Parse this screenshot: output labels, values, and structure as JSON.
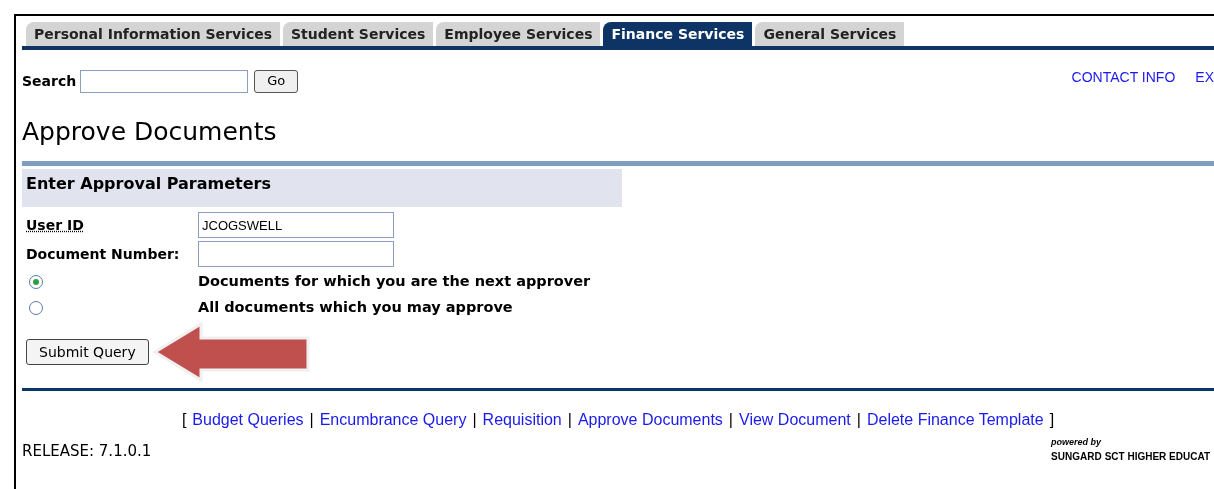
{
  "tabs": [
    {
      "label": "Personal Information Services",
      "selected": false
    },
    {
      "label": "Student Services",
      "selected": false
    },
    {
      "label": "Employee Services",
      "selected": false
    },
    {
      "label": "Finance Services",
      "selected": true
    },
    {
      "label": "General Services",
      "selected": false
    }
  ],
  "search": {
    "label": "Search",
    "button": "Go"
  },
  "header_links": [
    "CONTACT INFO",
    "EX"
  ],
  "title": "Approve Documents",
  "section": {
    "heading": "Enter Approval Parameters"
  },
  "fields": [
    {
      "label": "User ID",
      "value": "JCOGSWELL"
    },
    {
      "label": "Document Number:"
    }
  ],
  "options": [
    {
      "label": "Documents for which you are the next approver",
      "selected": true
    },
    {
      "label": "All documents which you may approve",
      "selected": false
    }
  ],
  "submit": "Submit Query",
  "footer": {
    "open_bracket": "[",
    "separator": "|",
    "close_bracket": "]",
    "links": [
      "Budget Queries",
      "Encumbrance Query",
      "Requisition",
      "Approve Documents",
      "View Document",
      "Delete Finance Template"
    ]
  },
  "release": "RELEASE: 7.1.0.1",
  "logo": {
    "tagline": "powered by",
    "brand": "SUNGARD",
    "product": "SCT HIGHER EDUCAT"
  }
}
